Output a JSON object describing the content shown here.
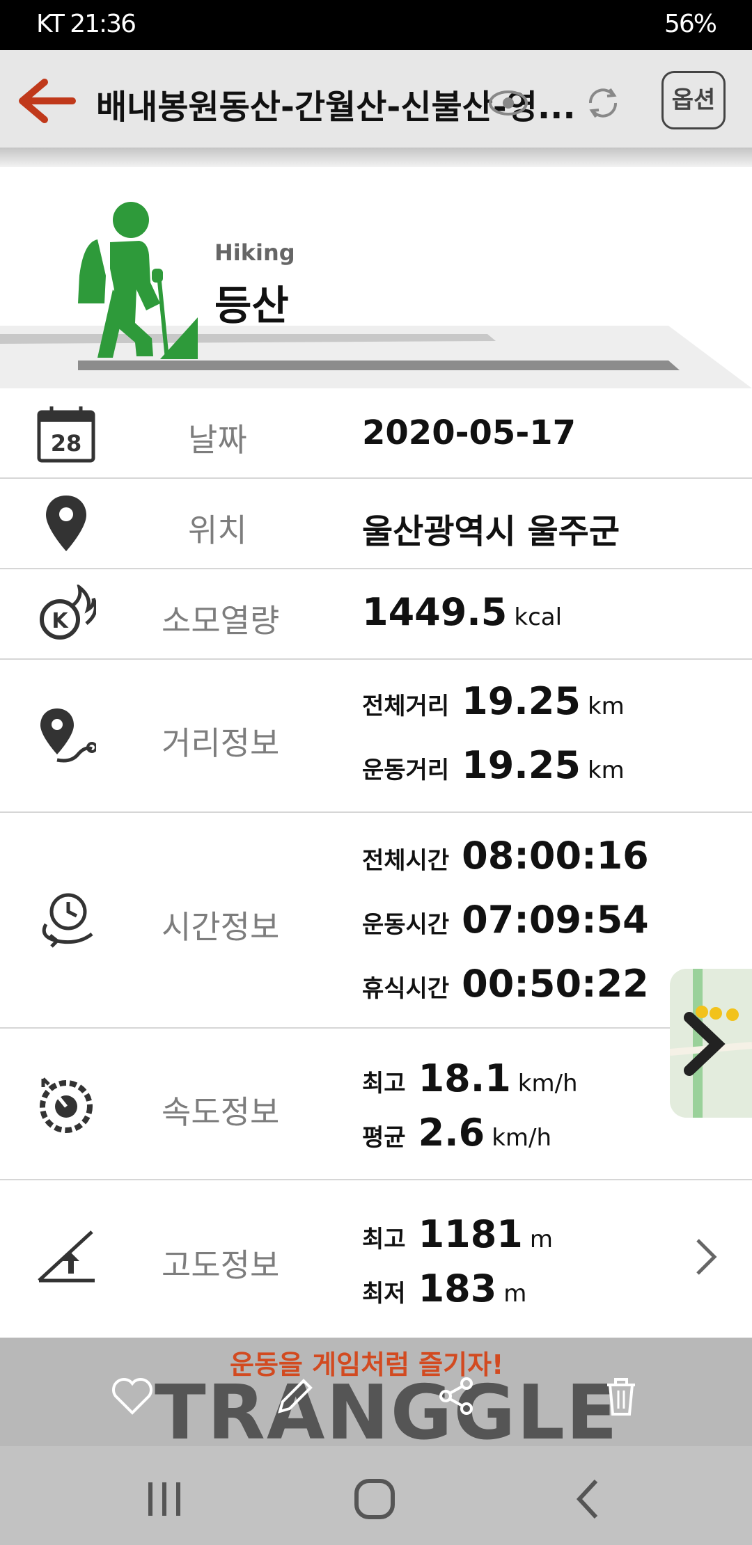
{
  "status_bar": {
    "left_text": "KT 21:36",
    "right_text": "56%"
  },
  "app_bar": {
    "title": "배내봉원동산-간월산-신불산-영...",
    "option_label": "옵션"
  },
  "header": {
    "activity_en": "Hiking",
    "activity_ko": "등산"
  },
  "rows": {
    "date": {
      "label": "날짜",
      "value": "2020-05-17"
    },
    "location": {
      "label": "위치",
      "value": "울산광역시 울주군"
    },
    "calories": {
      "label": "소모열량",
      "value": "1449.5",
      "unit": "kcal"
    },
    "distance": {
      "label": "거리정보",
      "total_label": "전체거리",
      "total_value": "19.25",
      "total_unit": "km",
      "active_label": "운동거리",
      "active_value": "19.25",
      "active_unit": "km"
    },
    "time": {
      "label": "시간정보",
      "total_label": "전체시간",
      "total_value": "08:00:16",
      "active_label": "운동시간",
      "active_value": "07:09:54",
      "rest_label": "휴식시간",
      "rest_value": "00:50:22"
    },
    "speed": {
      "label": "속도정보",
      "max_label": "최고",
      "max_value": "18.1",
      "max_unit": "km/h",
      "avg_label": "평균",
      "avg_value": "2.6",
      "avg_unit": "km/h"
    },
    "altitude": {
      "label": "고도정보",
      "max_label": "최고",
      "max_value": "1181",
      "max_unit": "m",
      "min_label": "최저",
      "min_value": "183",
      "min_unit": "m"
    }
  },
  "toolbar": {
    "slogan": "운동을 게임처럼 즐기자!",
    "brand": "TRANGGLE"
  },
  "colors": {
    "accent_green": "#2e9a3a",
    "back_arrow": "#c0391b",
    "slogan_red": "#d24a20"
  }
}
